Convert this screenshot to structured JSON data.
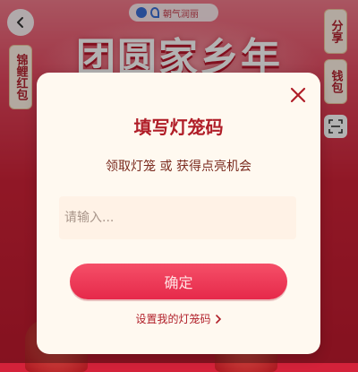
{
  "header": {
    "brand_text": "朝气润丽",
    "banner_title": "团圆家乡年"
  },
  "side_tags": {
    "left": "锦鲤红包",
    "share": "分享",
    "wallet": "钱包"
  },
  "modal": {
    "title": "填写灯笼码",
    "subtitle": "领取灯笼 或 获得点亮机会",
    "input_placeholder": "请输入...",
    "input_value": "",
    "confirm_label": "确定",
    "settings_link": "设置我的灯笼码"
  },
  "icons": {
    "back": "chevron-left-icon",
    "close": "close-icon",
    "scan": "scan-icon",
    "settings_arrow": "chevron-right-icon"
  },
  "colors": {
    "accent_red": "#b01e28",
    "button_red": "#e6294a",
    "modal_bg": "#fff9f0"
  }
}
